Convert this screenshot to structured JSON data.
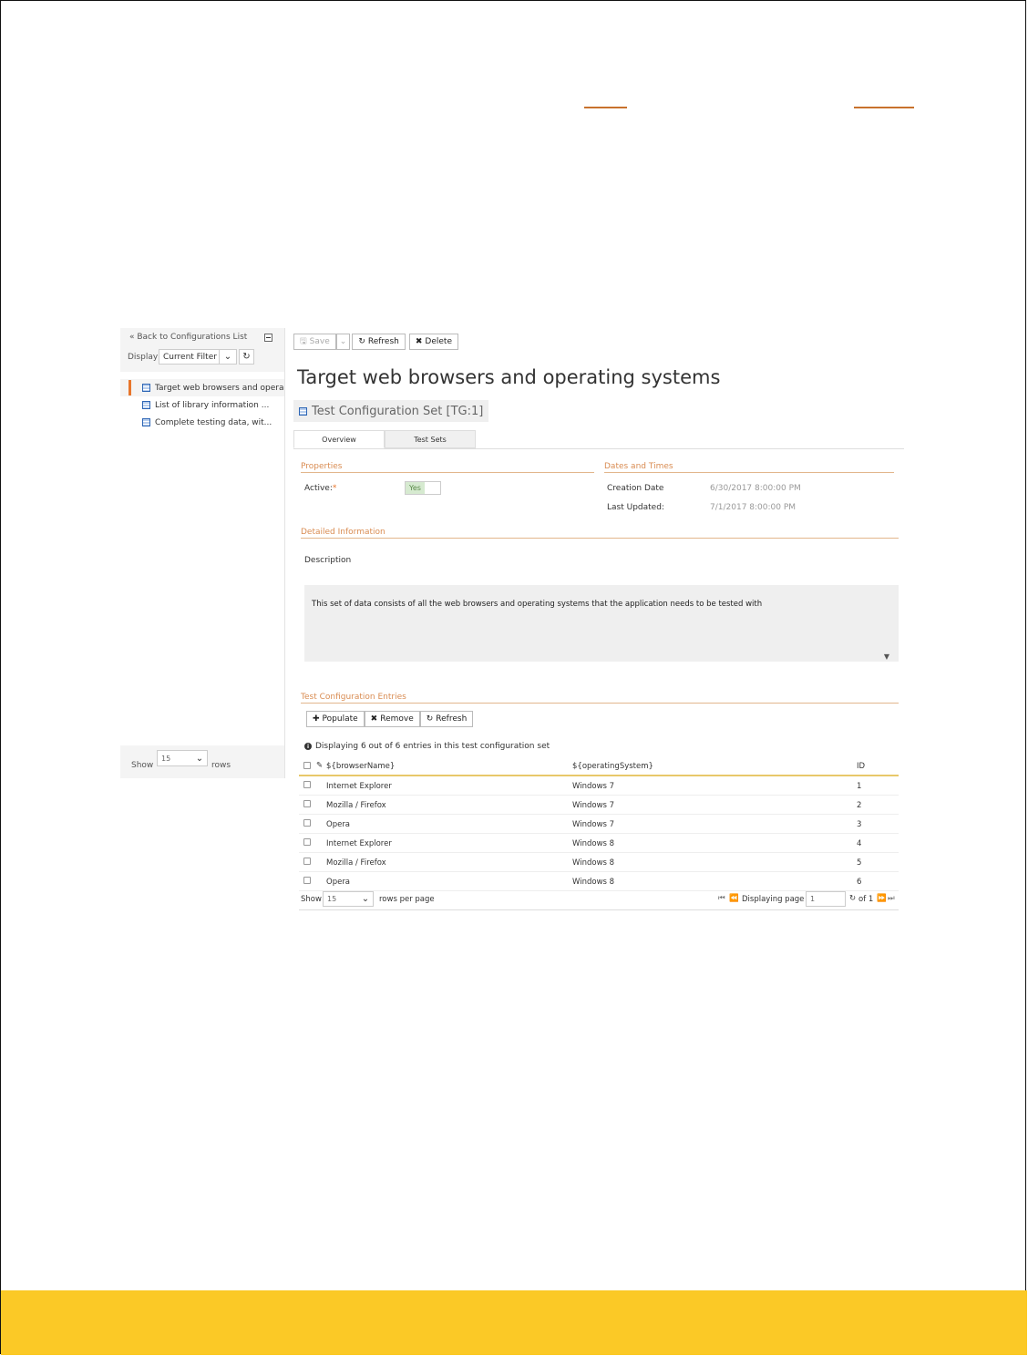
{
  "sidebar": {
    "back_link": "« Back to Configurations List",
    "display_label": "Display",
    "filter_value": "Current Filter",
    "items": [
      {
        "label": "Target web browsers and opera"
      },
      {
        "label": "List of library information ..."
      },
      {
        "label": "Complete testing data, wit..."
      }
    ],
    "show_label": "Show",
    "rows_value": "15",
    "rows_label": "rows"
  },
  "toolbar": {
    "save_label": "Save",
    "refresh_label": "Refresh",
    "delete_label": "Delete"
  },
  "page_title": "Target web browsers and operating systems",
  "artifact": "Test Configuration Set [TG:1]",
  "tabs": [
    {
      "label": "Overview",
      "active": true
    },
    {
      "label": "Test Sets",
      "active": false
    }
  ],
  "properties": {
    "heading": "Properties",
    "active_label": "Active:",
    "required_mark": "*",
    "active_value": "Yes"
  },
  "dates": {
    "heading": "Dates and Times",
    "creation_label": "Creation Date",
    "creation_value": "6/30/2017 8:00:00 PM",
    "updated_label": "Last Updated:",
    "updated_value": "7/1/2017 8:00:00 PM"
  },
  "detailed": {
    "heading": "Detailed Information",
    "description_label": "Description",
    "description_text": "This set of data consists of all the web browsers and operating systems that the application needs to be tested with"
  },
  "entries": {
    "heading": "Test Configuration Entries",
    "populate_label": "Populate",
    "remove_label": "Remove",
    "refresh_label": "Refresh",
    "info": "Displaying 6 out of 6 entries in this test configuration set",
    "columns": [
      "${browserName}",
      "${operatingSystem}",
      "ID"
    ],
    "rows": [
      {
        "browser": "Internet Explorer",
        "os": "Windows 7",
        "id": "1"
      },
      {
        "browser": "Mozilla / Firefox",
        "os": "Windows 7",
        "id": "2"
      },
      {
        "browser": "Opera",
        "os": "Windows 7",
        "id": "3"
      },
      {
        "browser": "Internet Explorer",
        "os": "Windows 8",
        "id": "4"
      },
      {
        "browser": "Mozilla / Firefox",
        "os": "Windows 8",
        "id": "5"
      },
      {
        "browser": "Opera",
        "os": "Windows 8",
        "id": "6"
      }
    ],
    "pager": {
      "show_label": "Show",
      "rows_value": "15",
      "rows_per_page": "rows per page",
      "displaying_page": "Displaying page",
      "page_value": "1",
      "of_label": "of 1"
    }
  },
  "colors": {
    "accent": "#e8762c",
    "footer": "#fbc926"
  }
}
